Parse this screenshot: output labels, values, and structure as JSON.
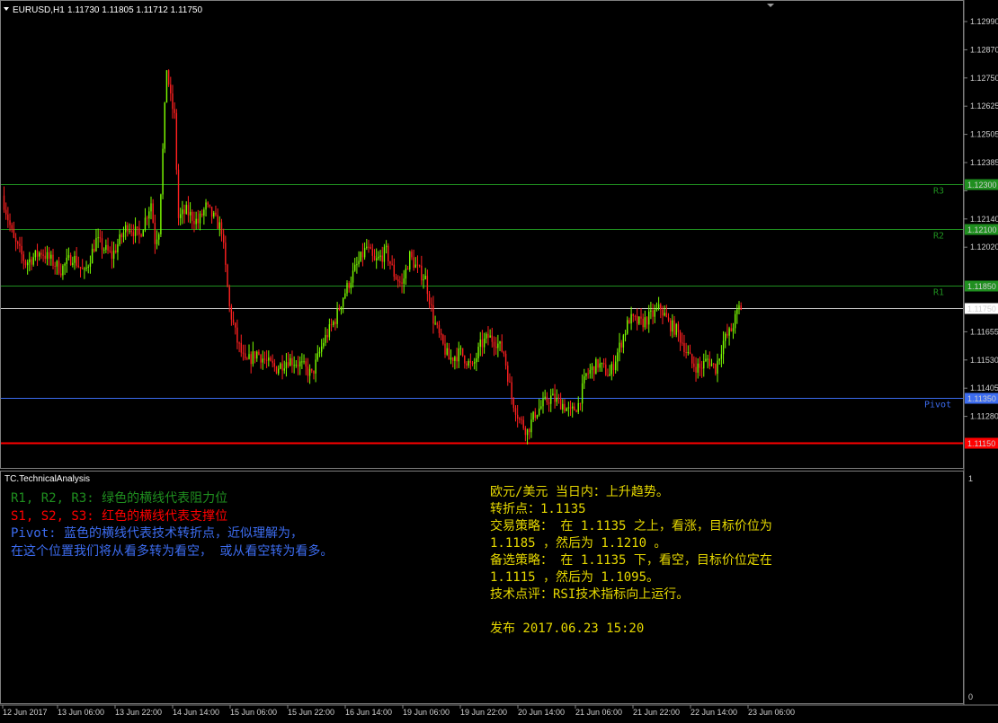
{
  "header": {
    "symbol": "EURUSD,H1",
    "ohlc": "1.11730 1.11805 1.11712 1.11750"
  },
  "indicator_title": "TC.TechnicalAnalysis",
  "subwindow_axis": [
    "1",
    "0"
  ],
  "colors": {
    "background": "#000000",
    "grid_border": "#7f7f7f",
    "bull_candle": "#7cfc00",
    "bear_candle": "#ff2020",
    "resistance": "#1f8f1f",
    "support": "#ff0000",
    "pivot": "#3c6cf0",
    "current_price": "#c0c0c0",
    "analysis_text": "#e6d800"
  },
  "legend": {
    "line1": "R1, R2, R3: 绿色的横线代表阻力位",
    "line2": "S1, S2, S3: 红色的横线代表支撑位",
    "line3": "Pivot: 蓝色的横线代表技术转折点，近似理解为，",
    "line4": "在这个位置我们将从看多转为看空， 或从看空转为看多。"
  },
  "analysis": {
    "line1": "欧元/美元 当日内：上升趋势。",
    "line2": "转折点：1.1135",
    "line3": "交易策略： 在 1.1135 之上，看涨，目标价位为",
    "line4": "1.1185 ，然后为 1.1210 。",
    "line5": "备选策略： 在 1.1135 下，看空，目标价位定在",
    "line6": "1.1115 ，然后为 1.1095。",
    "line7": "技术点评：RSI技术指标向上运行。",
    "line8": "发布 2017.06.23 15:20"
  },
  "chart_data": {
    "type": "candlestick",
    "symbol": "EURUSD",
    "timeframe": "H1",
    "y_ticks": [
      "1.12990",
      "1.12870",
      "1.12750",
      "1.12625",
      "1.12505",
      "1.12385",
      "1.12260",
      "1.12140",
      "1.12020",
      "1.11775",
      "1.11655",
      "1.11530",
      "1.11405",
      "1.11280"
    ],
    "ylim": [
      1.111,
      1.1305
    ],
    "x_ticks": [
      "12 Jun 2017",
      "13 Jun 06:00",
      "13 Jun 22:00",
      "14 Jun 14:00",
      "15 Jun 06:00",
      "15 Jun 22:00",
      "16 Jun 14:00",
      "19 Jun 06:00",
      "19 Jun 22:00",
      "20 Jun 14:00",
      "21 Jun 06:00",
      "21 Jun 22:00",
      "22 Jun 14:00",
      "23 Jun 06:00"
    ],
    "levels": [
      {
        "name": "R3",
        "price": 1.123,
        "label": "1.12300",
        "color": "#1f8f1f"
      },
      {
        "name": "R2",
        "price": 1.121,
        "label": "1.12100",
        "color": "#1f8f1f"
      },
      {
        "name": "R1",
        "price": 1.1185,
        "label": "1.11850",
        "color": "#1f8f1f"
      },
      {
        "name": "Pivot",
        "price": 1.1135,
        "label": "1.11350",
        "color": "#3c6cf0"
      },
      {
        "name": "",
        "price": 1.1115,
        "label": "1.11150",
        "color": "#ff0000"
      }
    ],
    "current_price": {
      "price": 1.1175,
      "label": "1.11750"
    },
    "path": [
      [
        0,
        1.1225
      ],
      [
        6,
        1.1205
      ],
      [
        12,
        1.1195
      ],
      [
        20,
        1.12
      ],
      [
        30,
        1.1192
      ],
      [
        36,
        1.1198
      ],
      [
        42,
        1.119
      ],
      [
        48,
        1.1205
      ],
      [
        56,
        1.1198
      ],
      [
        64,
        1.1212
      ],
      [
        70,
        1.1207
      ],
      [
        76,
        1.1222
      ],
      [
        78,
        1.1205
      ],
      [
        80,
        1.121
      ],
      [
        82,
        1.1245
      ],
      [
        84,
        1.1282
      ],
      [
        86,
        1.1268
      ],
      [
        88,
        1.126
      ],
      [
        90,
        1.1215
      ],
      [
        94,
        1.1218
      ],
      [
        100,
        1.1213
      ],
      [
        104,
        1.122
      ],
      [
        108,
        1.1215
      ],
      [
        112,
        1.121
      ],
      [
        116,
        1.1175
      ],
      [
        120,
        1.116
      ],
      [
        124,
        1.115
      ],
      [
        130,
        1.1155
      ],
      [
        136,
        1.115
      ],
      [
        140,
        1.1148
      ],
      [
        146,
        1.1152
      ],
      [
        152,
        1.115
      ],
      [
        158,
        1.1145
      ],
      [
        164,
        1.116
      ],
      [
        170,
        1.117
      ],
      [
        174,
        1.118
      ],
      [
        180,
        1.1192
      ],
      [
        186,
        1.1202
      ],
      [
        190,
        1.1195
      ],
      [
        196,
        1.12
      ],
      [
        200,
        1.119
      ],
      [
        204,
        1.1185
      ],
      [
        208,
        1.1198
      ],
      [
        212,
        1.1192
      ],
      [
        216,
        1.1188
      ],
      [
        220,
        1.117
      ],
      [
        224,
        1.116
      ],
      [
        228,
        1.1152
      ],
      [
        234,
        1.1155
      ],
      [
        240,
        1.1148
      ],
      [
        244,
        1.1158
      ],
      [
        248,
        1.1162
      ],
      [
        252,
        1.116
      ],
      [
        256,
        1.1155
      ],
      [
        260,
        1.1135
      ],
      [
        264,
        1.1125
      ],
      [
        268,
        1.112
      ],
      [
        272,
        1.1128
      ],
      [
        276,
        1.1132
      ],
      [
        280,
        1.1135
      ],
      [
        286,
        1.1132
      ],
      [
        290,
        1.1128
      ],
      [
        294,
        1.1132
      ],
      [
        298,
        1.1145
      ],
      [
        304,
        1.115
      ],
      [
        310,
        1.1145
      ],
      [
        316,
        1.116
      ],
      [
        320,
        1.117
      ],
      [
        326,
        1.1168
      ],
      [
        332,
        1.1172
      ],
      [
        336,
        1.1175
      ],
      [
        340,
        1.1168
      ],
      [
        344,
        1.1165
      ],
      [
        348,
        1.1158
      ],
      [
        352,
        1.115
      ],
      [
        356,
        1.1148
      ],
      [
        360,
        1.1152
      ],
      [
        364,
        1.1148
      ],
      [
        368,
        1.116
      ],
      [
        372,
        1.1165
      ],
      [
        374,
        1.117
      ],
      [
        376,
        1.1175
      ]
    ]
  }
}
